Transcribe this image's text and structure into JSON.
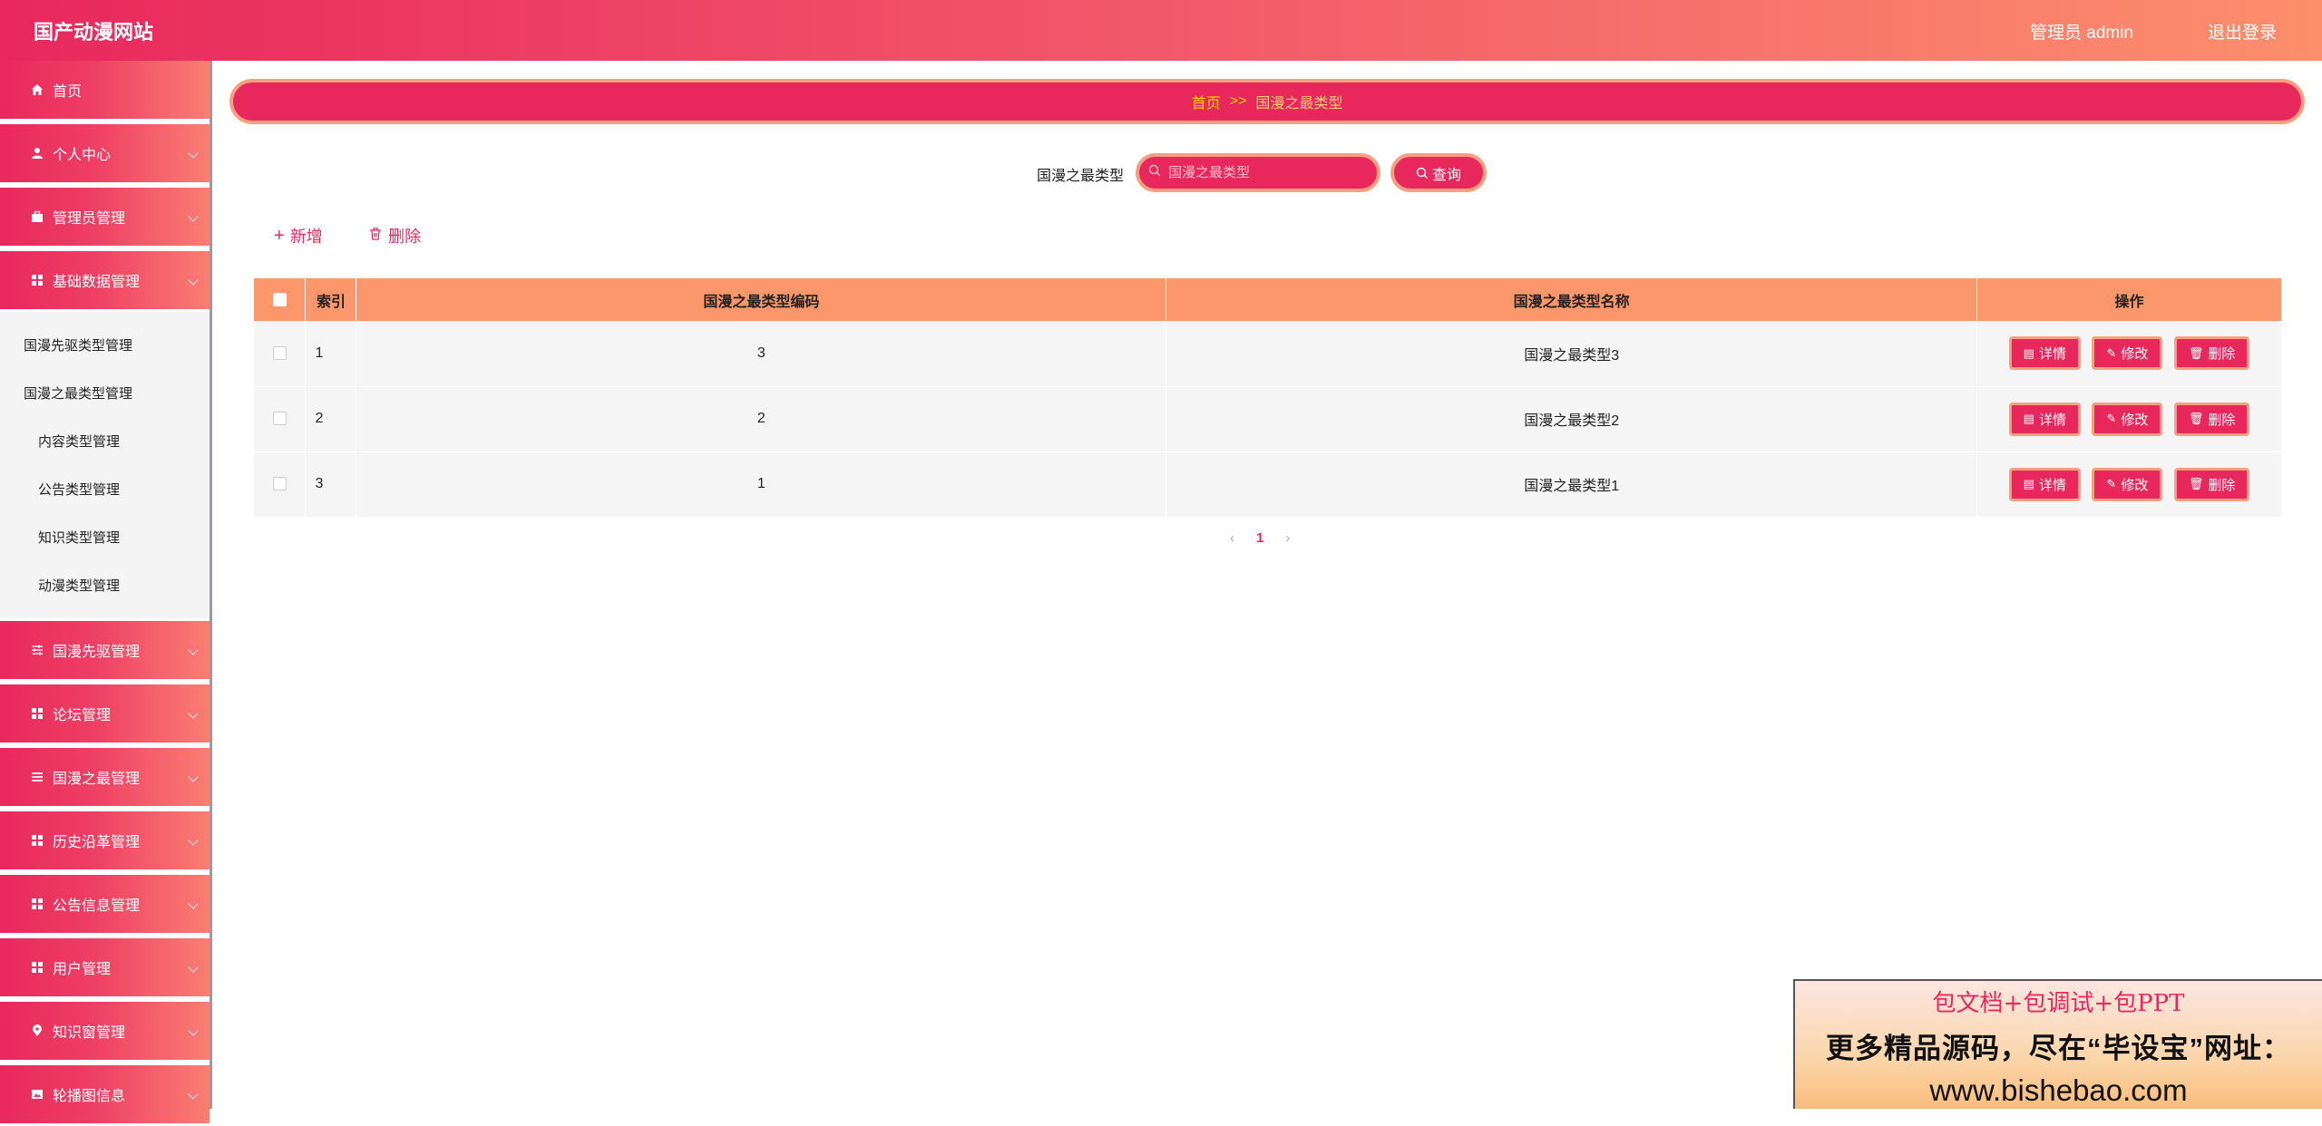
{
  "header": {
    "title": "国产动漫网站",
    "user": "管理员 admin",
    "logout": "退出登录"
  },
  "sidebar": {
    "items": [
      {
        "label": "首页",
        "icon": "home-icon",
        "expandable": false
      },
      {
        "label": "个人中心",
        "icon": "user-icon",
        "expandable": true
      },
      {
        "label": "管理员管理",
        "icon": "briefcase-icon",
        "expandable": true
      },
      {
        "label": "基础数据管理",
        "icon": "grid-icon",
        "expandable": true,
        "expanded": true
      },
      {
        "label": "国漫先驱管理",
        "icon": "sliders-icon",
        "expandable": true
      },
      {
        "label": "论坛管理",
        "icon": "grid-icon",
        "expandable": true
      },
      {
        "label": "国漫之最管理",
        "icon": "list-icon",
        "expandable": true
      },
      {
        "label": "历史沿革管理",
        "icon": "grid-icon",
        "expandable": true
      },
      {
        "label": "公告信息管理",
        "icon": "grid-icon",
        "expandable": true
      },
      {
        "label": "用户管理",
        "icon": "grid-icon",
        "expandable": true
      },
      {
        "label": "知识窗管理",
        "icon": "pin-icon",
        "expandable": true
      },
      {
        "label": "轮播图信息",
        "icon": "image-icon",
        "expandable": true
      }
    ],
    "submenu": [
      {
        "label": "国漫先驱类型管理"
      },
      {
        "label": "国漫之最类型管理"
      },
      {
        "label": "内容类型管理"
      },
      {
        "label": "公告类型管理"
      },
      {
        "label": "知识类型管理"
      },
      {
        "label": "动漫类型管理"
      }
    ]
  },
  "breadcrumb": {
    "home": "首页",
    "separator": ">>",
    "current": "国漫之最类型"
  },
  "search": {
    "label": "国漫之最类型",
    "placeholder": "国漫之最类型",
    "value": "",
    "button": "查询"
  },
  "toolbar": {
    "add": "新增",
    "delete": "删除"
  },
  "table": {
    "columns": [
      "索引",
      "国漫之最类型编码",
      "国漫之最类型名称",
      "操作"
    ],
    "rows": [
      {
        "index": "1",
        "code": "3",
        "name": "国漫之最类型3"
      },
      {
        "index": "2",
        "code": "2",
        "name": "国漫之最类型2"
      },
      {
        "index": "3",
        "code": "1",
        "name": "国漫之最类型1"
      }
    ],
    "actions": {
      "detail": "详情",
      "edit": "修改",
      "delete": "删除"
    }
  },
  "pagination": {
    "current_page": "1"
  },
  "promo": {
    "line1": "包文档+包调试+包PPT",
    "line2": "更多精品源码，尽在“毕设宝”网址：",
    "line3": "www.bishebao.com"
  },
  "colors": {
    "primary": "#e8285c",
    "accent": "#f7a07f",
    "table_header": "#fc966b",
    "breadcrumb_text": "#ffd400"
  }
}
